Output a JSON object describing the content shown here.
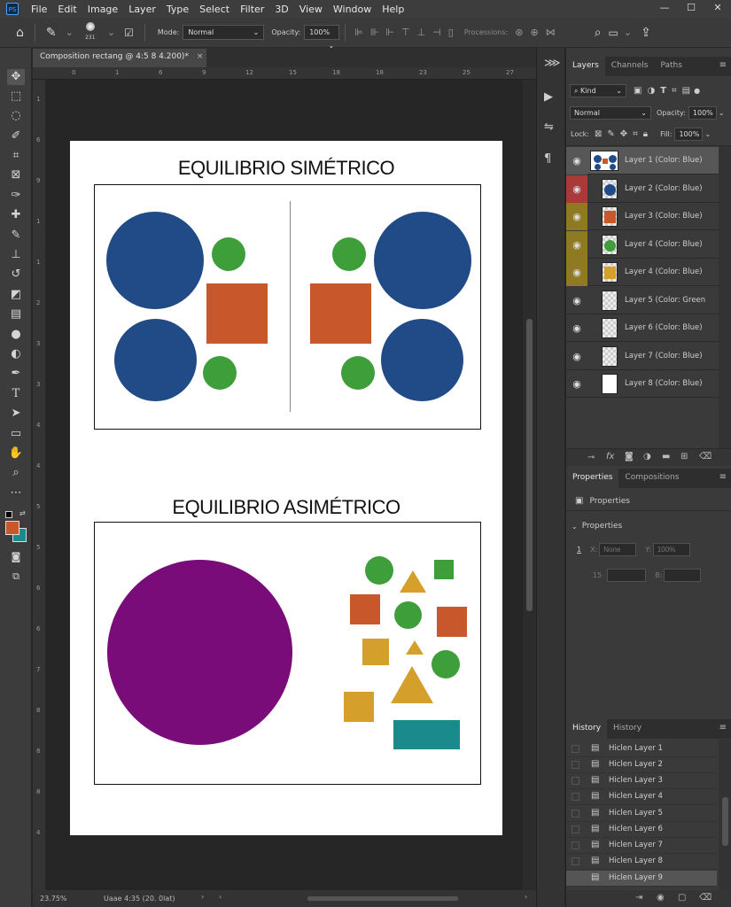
{
  "app": {
    "logo": "PS"
  },
  "menu": [
    "File",
    "Edit",
    "Image",
    "Layer",
    "Type",
    "Select",
    "Filter",
    "3D",
    "View",
    "Window",
    "Help"
  ],
  "window_controls": [
    "—",
    "☐",
    "✕"
  ],
  "options_bar": {
    "brush_size": "231",
    "mode_label": "Mode:",
    "mode_value": "Normal",
    "opacity_label": "Opacity:",
    "opacity_value": "100%",
    "processions_label": "Processions:"
  },
  "document": {
    "tab_title": "Composition rectang @ 4:5 8 4.200)*",
    "tab_close": "×",
    "zoom": "23.75%",
    "doc_info": "Uaae 4:35 (20. 0lat)",
    "ruler_top": [
      "0",
      "1",
      "6",
      "9",
      "12",
      "15",
      "18",
      "18",
      "23",
      "25",
      "27"
    ],
    "ruler_left": [
      "1",
      "6",
      "9",
      "1",
      "1",
      "2",
      "3",
      "3",
      "4",
      "4",
      "5",
      "5",
      "6",
      "6",
      "7",
      "8",
      "8",
      "8",
      "4"
    ]
  },
  "artboard": {
    "symmetric_title": "EQUILIBRIO SIMÉTRICO",
    "asymmetric_title": "EQUILIBRIO ASIMÉTRICO"
  },
  "colors": {
    "blue": "#214b86",
    "green": "#3e9e3a",
    "orange": "#c8582b",
    "purple": "#7a0c7a",
    "yellow": "#d4a02b",
    "teal": "#1a8a8d"
  },
  "layers_panel": {
    "tabs": [
      "Layers",
      "Channels",
      "Paths"
    ],
    "kind_filter": "Kind",
    "blend_mode": "Normal",
    "opacity_label": "Opacity:",
    "opacity_value": "100%",
    "lock_label": "Lock:",
    "fill_label": "Fill:",
    "fill_value": "100%",
    "layers": [
      {
        "name": "Layer 1 (Color: Blue)",
        "tag_color": "#575757",
        "thumb": "composition"
      },
      {
        "name": "Layer 2 (Color: Blue)",
        "tag_color": "#a83a3a",
        "thumb": "blue-circle"
      },
      {
        "name": "Layer 3 (Color: Blue)",
        "tag_color": "#8f7a23",
        "thumb": "orange-square"
      },
      {
        "name": "Layer 4 (Color: Blue)",
        "tag_color": "#8f7a23",
        "thumb": "green-circle"
      },
      {
        "name": "Layer 4 (Color: Blue)",
        "tag_color": "#8f7a23",
        "thumb": "yellow-square"
      },
      {
        "name": "Layer 5 (Color: Green",
        "tag_color": "#3a3a3a",
        "thumb": "transparent"
      },
      {
        "name": "Layer 6 (Color: Blue)",
        "tag_color": "#3a3a3a",
        "thumb": "transparent"
      },
      {
        "name": "Layer 7 (Color: Blue)",
        "tag_color": "#3a3a3a",
        "thumb": "transparent"
      },
      {
        "name": "Layer 8 (Color: Blue)",
        "tag_color": "#3a3a3a",
        "thumb": "white"
      }
    ]
  },
  "properties_panel": {
    "tabs": [
      "Properties",
      "Compositions"
    ],
    "header": "Properties",
    "section": "Properties",
    "x_label": "X:",
    "x_placeholder": "None",
    "y_label": "Y:",
    "y_placeholder": "100%",
    "w_label": "15",
    "b_label": "B:"
  },
  "history_panel": {
    "tabs": [
      "History",
      "History"
    ],
    "items": [
      "Hiclen Layer 1",
      "Hiclen Layer 2",
      "Hiclen Layer 3",
      "Hiclen Layer 4",
      "Hiclen Layer 5",
      "Hiclen Layer 6",
      "Hiclen Layer 7",
      "Hiclen Layer 8",
      "Hiclen Layer 9"
    ]
  }
}
